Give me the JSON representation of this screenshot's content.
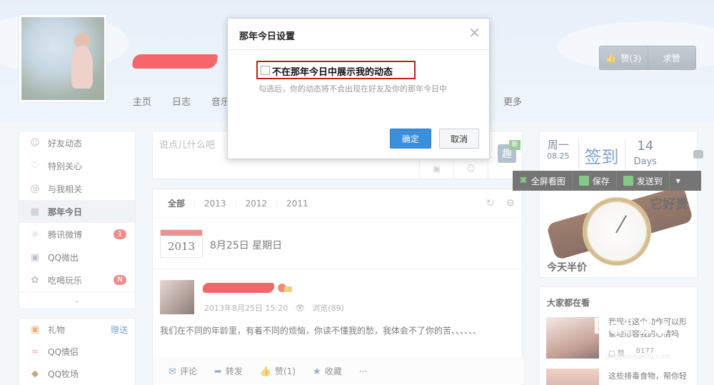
{
  "colors": {
    "accent": "#3c8fdb",
    "badge": "#e25454",
    "highlight": "#c01f1f",
    "scribble": "#f0141b"
  },
  "header": {
    "nav": [
      "主页",
      "日志",
      "音乐"
    ],
    "nav_more": "更多",
    "like_label": "赞(3)",
    "ask_like_label": "求赞"
  },
  "sidebar": {
    "items": [
      {
        "label": "好友动态",
        "icon": "person-icon"
      },
      {
        "label": "特别关心",
        "icon": "heart-icon"
      },
      {
        "label": "与我相关",
        "icon": "at-icon"
      },
      {
        "label": "那年今日",
        "icon": "calendar-icon",
        "active": true
      },
      {
        "label": "腾讯微博",
        "icon": "weibo-icon",
        "badge": "1"
      },
      {
        "label": "QQ微出",
        "icon": "film-icon"
      },
      {
        "label": "吃喝玩乐",
        "icon": "puzzle-icon",
        "badge": "N"
      }
    ],
    "more_icon": "chevron-down-icon"
  },
  "sidebar2": {
    "items": [
      {
        "label": "礼物",
        "link": "赠送"
      },
      {
        "label": "QQ情侣"
      },
      {
        "label": "QQ牧场"
      }
    ]
  },
  "postbox": {
    "placeholder": "说点儿什么吧",
    "qu": "趣",
    "new_tag": "新"
  },
  "feed": {
    "tabs": [
      "全部",
      "2013",
      "2012",
      "2011"
    ],
    "calendar_year": "2013",
    "date": "8月25日 星期日",
    "post": {
      "time": "2013年8月25日 15:20",
      "views": "浏览(89)",
      "text": "我们在不同的年龄里，有着不同的烦恼，你读不懂我的愁，我体会不了你的苦、、、、、、"
    },
    "actions": {
      "comment": "评论",
      "forward": "转发",
      "like": "赞(1)",
      "collect": "收藏",
      "more": "···"
    }
  },
  "sign": {
    "week": "周一",
    "date": "08.25",
    "main": "签到",
    "days_num": "14",
    "days_label": "Days"
  },
  "image_toolbar": {
    "fullscreen": "全屏看图",
    "save": "保存",
    "send": "发送到"
  },
  "ad": {
    "title": "它好贵",
    "bottom": "今天半价"
  },
  "hot": {
    "title": "大家都在看",
    "item1_text": "我现在这个动作可以形象地形容我的心情吗",
    "item1_likes": "赞",
    "item1_views": "8177",
    "item2_text": "这些排毒食物，帮你轻"
  },
  "modal": {
    "title": "那年今日设置",
    "checkbox_label": "不在那年今日中展示我的动态",
    "hint": "勾选后，你的动态将不会出现在好友及你的那年今日中",
    "ok": "确定",
    "cancel": "取消"
  },
  "watermark": {
    "text": "Bai du",
    "url": "jingyan.baidu.com"
  }
}
